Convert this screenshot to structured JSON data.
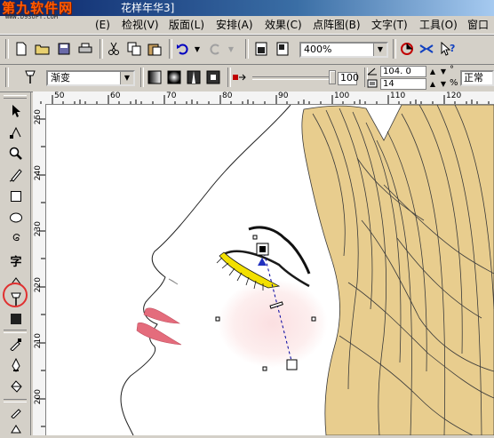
{
  "window": {
    "site_logo": "第九软件网",
    "site_url": "WWW.D9SOFT.COM",
    "title": "花样年华3]"
  },
  "menu": [
    {
      "label": "(E)"
    },
    {
      "label": "检视(V)"
    },
    {
      "label": "版面(L)"
    },
    {
      "label": "安排(A)"
    },
    {
      "label": "效果(C)"
    },
    {
      "label": "点阵图(B)"
    },
    {
      "label": "文字(T)"
    },
    {
      "label": "工具(O)"
    },
    {
      "label": "窗口"
    }
  ],
  "standard_toolbar": {
    "zoom_value": "400%"
  },
  "property_bar": {
    "fill_type": "渐变",
    "midpoint_value": "100",
    "angle_value": "104. 0",
    "edge_pad_value": "14",
    "degree_unit": "°",
    "percent_unit": "%",
    "mode_value": "正常"
  },
  "ruler_top": [
    "50",
    "60",
    "70",
    "80",
    "90",
    "100",
    "110",
    "120"
  ],
  "ruler_left": [
    "250",
    "240",
    "230",
    "220",
    "210",
    "200"
  ],
  "colors": {
    "hair": "#e8cd8e",
    "lips": "#e46c7c",
    "lashes": "#f2e000",
    "blush": "#fbdfe1",
    "highlight_tool_circle": "#e03030",
    "title_bar": "#0a246a"
  }
}
